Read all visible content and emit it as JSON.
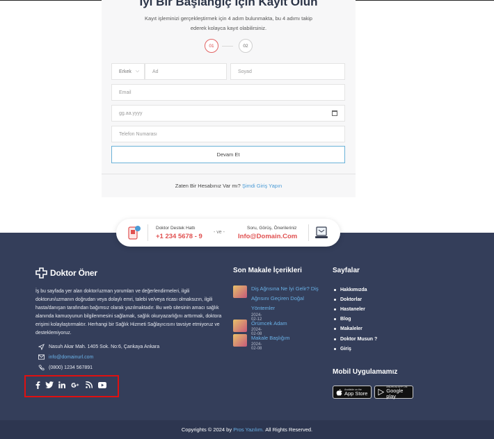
{
  "card": {
    "title": "İyi Bir Başlangıç İçin Kayıt Olun",
    "subtitle": "Kayıt işleminizi gerçekleştirmek için 4 adım bulunmakta, bu 4 adımı takip ederek kolayca kayıt olabilirsiniz.",
    "steps": [
      "01",
      "02"
    ],
    "gender_value": "Erkek",
    "name_placeholder": "Ad",
    "surname_placeholder": "Soyad",
    "email_placeholder": "Email",
    "date_placeholder": "gg.aa.yyyy",
    "phone_placeholder": "Telefon Numarası",
    "continue_label": "Devam Et",
    "login_prompt": "Zaten Bir Hesabınız Var mı?",
    "login_link": "Şimdi Giriş Yapın"
  },
  "contact_pill": {
    "support_label": "Doktor Destek Hattı",
    "support_phone": "+1 234 5678 - 9",
    "and_text": "- ve -",
    "feedback_label": "Soru, Görüş, Önerileriniz",
    "feedback_email": "Info@Domain.Com"
  },
  "footer": {
    "brand": "Doktor Öner",
    "about": "İş bu sayfada yer alan doktor/uzman yorumları ve değerlendirmeleri, ilgili doktorun/uzmanın doğrudan veya dolaylı emri, talebi ve/veya ricası olmaksızın, ilgili hasta/danışan tarafından bağımsız olarak yazılmaktadır. Bu web sitesinin amacı sağlık alanında kamuoyunun bilgilenmesini sağlamak, sağlık okuryazarlığını arttırmak, doktora erişimi kolaylaştırmaktır. Herhangi bir Sağlık Hizmeti Sağlayıcısını tavsiye etmiyoruz ve desteklemiyoruz.",
    "address": "Nasuh Akar Mah. 1405 Sok. No:6, Çankaya Ankara",
    "email": "info@domainurl.com",
    "phone": "(0800) 1234 567891",
    "articles_title": "Son Makale İçerikleri",
    "articles": [
      {
        "title": "Diş Ağrısına Ne İyi Gelir? Diş Ağrısını Geçiren Doğal Yöntemler",
        "date": "2024-02-12"
      },
      {
        "title": "Örümcek Adam",
        "date": "2024-02-08"
      },
      {
        "title": "Makale Başlığım",
        "date": "2024-02-08"
      }
    ],
    "pages_title": "Sayfalar",
    "pages": [
      "Hakkımızda",
      "Doktorlar",
      "Hastaneler",
      "Blog",
      "Makaleler",
      "Doktor Musun ?",
      "Giriş"
    ],
    "mobile_title": "Mobil Uygulamamız",
    "app_store_small": "Available on the",
    "app_store_big": "App Store",
    "google_play_small": "ANDROID APP ON",
    "google_play_big": "Google play",
    "copyright_prefix": "Copyrights © 2024 by",
    "copyright_link": "Pros Yazılım.",
    "copyright_suffix": "All Rights Reserved."
  },
  "icons": {
    "social": [
      "facebook-icon",
      "twitter-icon",
      "linkedin-icon",
      "google-plus-icon",
      "rss-icon",
      "youtube-icon"
    ]
  },
  "colors": {
    "footer_bg": "#343e5a",
    "accent_red": "#e05050",
    "link_blue": "#6ab2e8",
    "highlight": "#e01010"
  }
}
